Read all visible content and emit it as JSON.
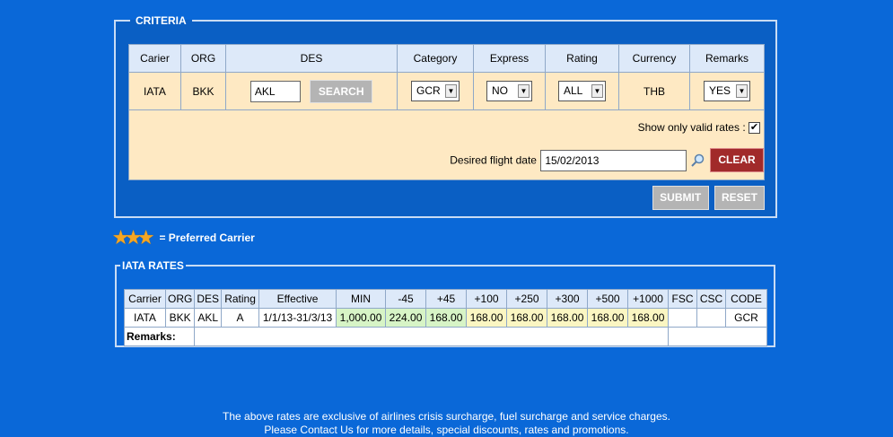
{
  "criteria": {
    "legend": "CRITERIA",
    "headers": [
      "Carier",
      "ORG",
      "DES",
      "Category",
      "Express",
      "Rating",
      "Currency",
      "Remarks"
    ],
    "carrier": "IATA",
    "org": "BKK",
    "des_value": "AKL",
    "search_label": "SEARCH",
    "category": "GCR",
    "express": "NO",
    "rating": "ALL",
    "currency": "THB",
    "remarks": "YES",
    "valid_rates_label": "Show only valid rates :",
    "flight_date_label": "Desired flight date",
    "flight_date_value": "15/02/2013",
    "clear_label": "CLEAR",
    "submit_label": "SUBMIT",
    "reset_label": "RESET"
  },
  "preferred": {
    "stars": "★★★",
    "text": "= Preferred Carrier"
  },
  "iata": {
    "legend": "IATA RATES",
    "headers": [
      "Carrier",
      "ORG",
      "DES",
      "Rating",
      "Effective",
      "MIN",
      "-45",
      "+45",
      "+100",
      "+250",
      "+300",
      "+500",
      "+1000",
      "FSC",
      "CSC",
      "CODE"
    ],
    "row": [
      "IATA",
      "BKK",
      "AKL",
      "A",
      "1/1/13-31/3/13",
      "1,000.00",
      "224.00",
      "168.00",
      "168.00",
      "168.00",
      "168.00",
      "168.00",
      "168.00",
      "",
      "",
      "GCR"
    ],
    "remarks_label": "Remarks:"
  },
  "footer": {
    "line1": "The above rates are exclusive of airlines crisis surcharge, fuel surcharge and service charges.",
    "line2": "Please Contact Us for more details, special discounts, rates and promotions."
  }
}
